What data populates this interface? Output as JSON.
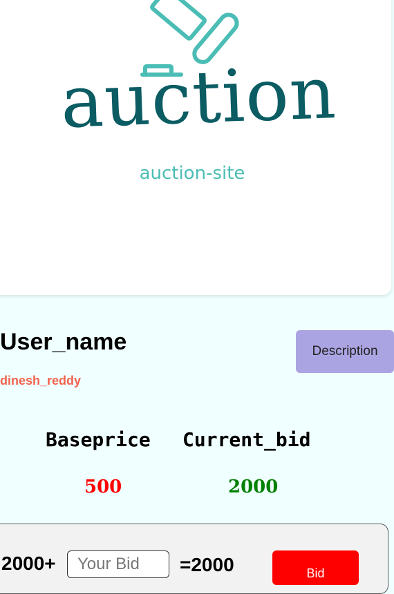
{
  "logo": {
    "word": "auction",
    "tagline": "auction-site",
    "icon": "gavel-icon"
  },
  "user": {
    "label": "User_name",
    "value": "dinesh_reddy"
  },
  "description_button": {
    "label": "Description"
  },
  "prices": {
    "base_label": "Baseprice",
    "base_value": "500",
    "current_label": "Current_bid",
    "current_value": "2000"
  },
  "bid": {
    "prefix": "2000+",
    "placeholder": "Your Bid",
    "total": "=2000",
    "button_label": "Bid"
  },
  "colors": {
    "background": "#f0ffff",
    "logo_dark": "#0b5c63",
    "logo_light": "#4bbdb5",
    "username": "#f2634f",
    "description_button": "#aba4e2",
    "base_price": "#ff0000",
    "current_bid": "#008000",
    "bid_button": "#ff0000"
  }
}
